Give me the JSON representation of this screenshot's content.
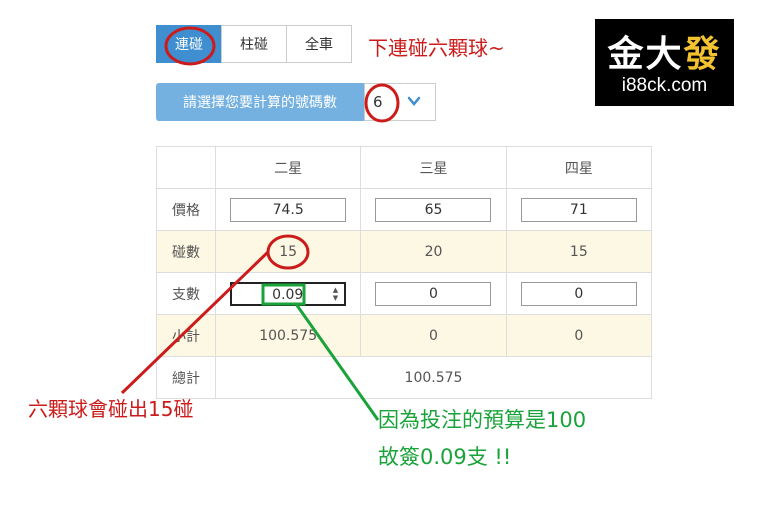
{
  "tabs": [
    {
      "label": "連碰",
      "active": true
    },
    {
      "label": "柱碰",
      "active": false
    },
    {
      "label": "全車",
      "active": false
    }
  ],
  "selector": {
    "label": "請選擇您要計算的號碼數",
    "value": "6"
  },
  "table": {
    "headers": [
      "",
      "二星",
      "三星",
      "四星"
    ],
    "price": {
      "label": "價格",
      "values": [
        "74.5",
        "65",
        "71"
      ]
    },
    "hits": {
      "label": "碰數",
      "values": [
        "15",
        "20",
        "15"
      ]
    },
    "count": {
      "label": "支數",
      "values": [
        "0.09",
        "0",
        "0"
      ]
    },
    "subtotal": {
      "label": "小計",
      "values": [
        "100.575",
        "0",
        "0"
      ]
    },
    "total": {
      "label": "總計",
      "value": "100.575"
    }
  },
  "annotations": {
    "top": "下連碰六顆球~",
    "left": "六顆球會碰出15碰",
    "right_line1": "因為投注的預算是100",
    "right_line2": "故簽0.09支 !!"
  },
  "logo": {
    "name_part1": "金大",
    "name_part2": "發",
    "url": "i88ck.com"
  },
  "colors": {
    "accent": "#3e8ed0",
    "highlight_row": "#fcf8e3",
    "red": "#cc1b1b",
    "green": "#19a33a"
  }
}
